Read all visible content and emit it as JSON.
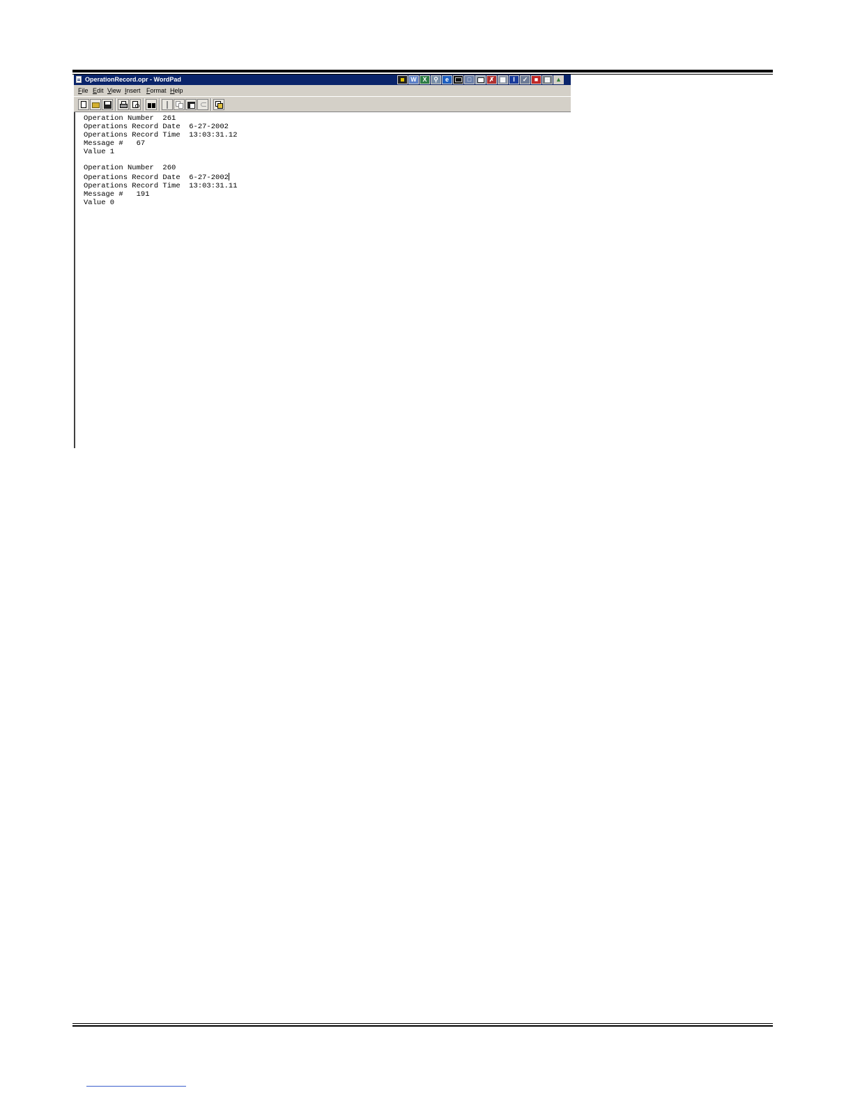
{
  "window": {
    "title": "OperationRecord.opr - WordPad"
  },
  "menu": {
    "items": [
      "File",
      "Edit",
      "View",
      "Insert",
      "Format",
      "Help"
    ]
  },
  "toolbar": {
    "buttons": [
      "new-icon",
      "open-icon",
      "save-icon",
      "print-icon",
      "print-preview-icon",
      "find-icon",
      "cut-icon",
      "copy-icon",
      "paste-icon",
      "undo-icon",
      "insert-datetime-icon"
    ]
  },
  "tray": {
    "icons": [
      "app-icon",
      "word-icon",
      "excel-icon",
      "search-icon",
      "ie-icon",
      "terminal-icon",
      "monitor-icon",
      "window-icon",
      "tool-icon",
      "printer-icon",
      "blue-app-icon",
      "edit-icon",
      "red-app-icon",
      "network-icon",
      "tree-icon"
    ]
  },
  "document": {
    "lines": [
      "Operation Number  261",
      "Operations Record Date  6-27-2002",
      "Operations Record Time  13:03:31.12",
      "Message #   67",
      "Value 1",
      "",
      "Operation Number  260",
      "Operations Record Date  6-27-2002",
      "Operations Record Time  13:03:31.11",
      "Message #   191",
      "Value 0"
    ]
  },
  "colors": {
    "titlebar": "#0a246a",
    "chrome": "#d4d0c8"
  }
}
